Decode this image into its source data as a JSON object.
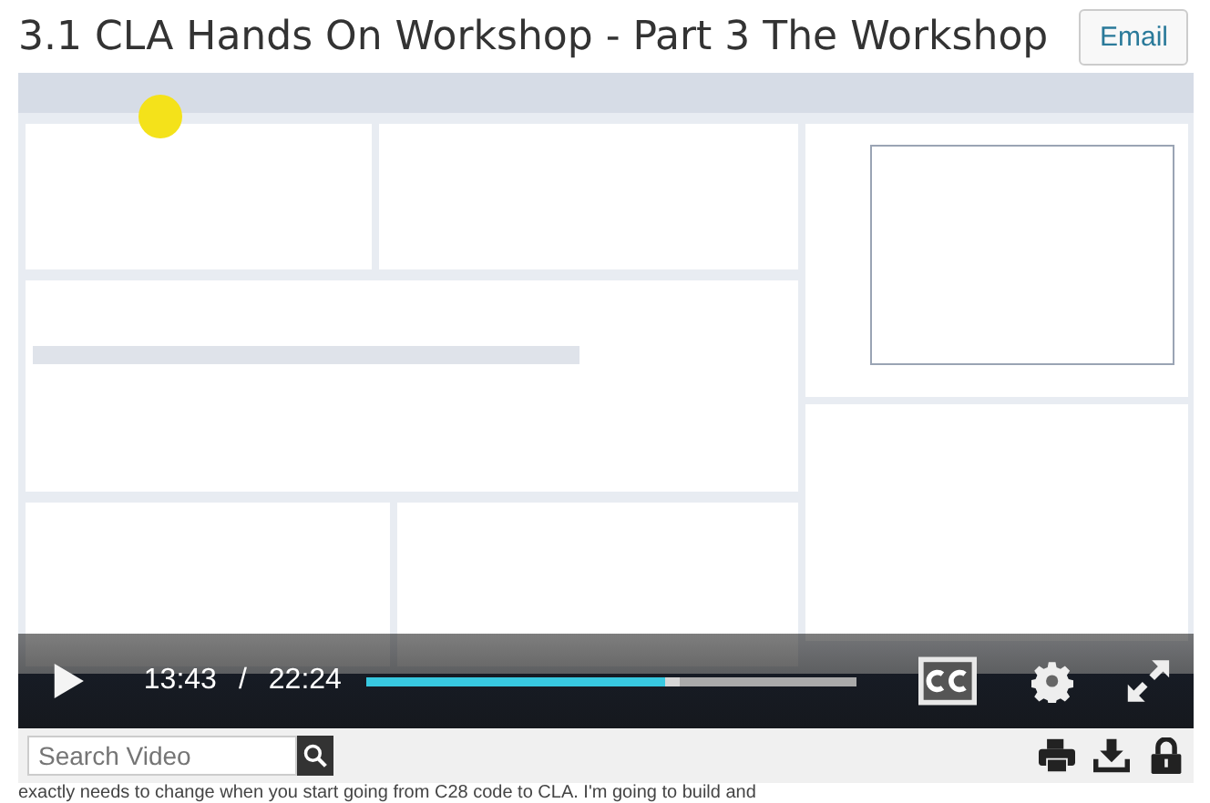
{
  "title": "3.1 CLA Hands On Workshop - Part 3 The Workshop",
  "email_button": "Email",
  "video": {
    "current_time": "13:43",
    "separator": "/",
    "duration": "22:24",
    "level": 0.61
  },
  "search": {
    "placeholder": "Search Video"
  },
  "transcript_line": "exactly needs to change when you start going from C28 code to CLA. I'm going to build and"
}
